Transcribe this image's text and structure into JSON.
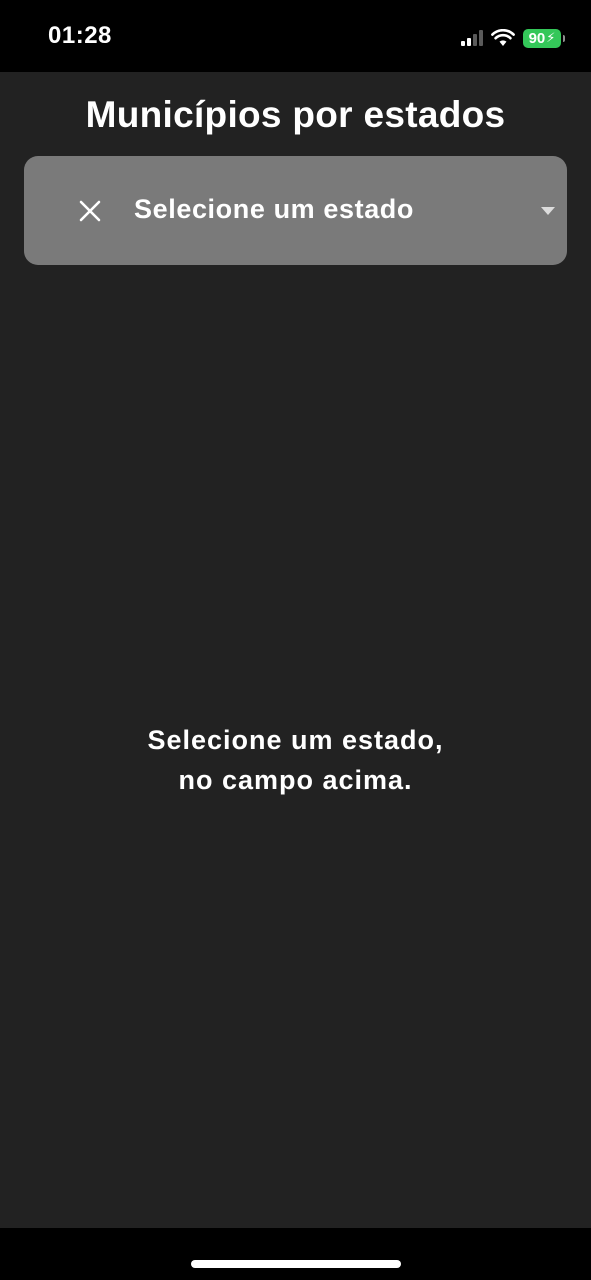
{
  "status_bar": {
    "time": "01:28",
    "battery_level": "90",
    "battery_color": "#34c759",
    "icons": [
      "signal-icon",
      "wifi-icon",
      "battery-icon",
      "charging-bolt-icon"
    ]
  },
  "header": {
    "title": "Municípios por estados"
  },
  "state_select": {
    "placeholder": "Selecione um estado",
    "clear_icon": "close-icon",
    "dropdown_icon": "chevron-down-icon",
    "background_color": "#7a7a7a"
  },
  "empty_state": {
    "line1": "Selecione um estado,",
    "line2": "no campo acima."
  },
  "theme": {
    "background": "#222222",
    "text": "#ffffff"
  }
}
